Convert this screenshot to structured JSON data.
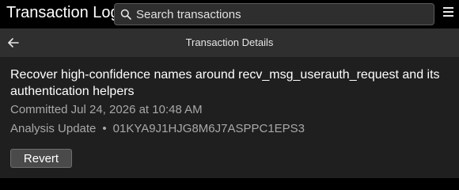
{
  "header": {
    "app_title": "Transaction Log",
    "search": {
      "placeholder": "Search transactions",
      "icon": "search-icon"
    },
    "menu_icon": "hamburger-menu-icon"
  },
  "subheader": {
    "back_icon": "arrow-left-icon",
    "title": "Transaction Details"
  },
  "transaction": {
    "message": "Recover high-confidence names around recv_msg_userauth_request and its authentication helpers",
    "committed": "Committed Jul 24, 2026 at 10:48 AM",
    "type": "Analysis Update",
    "separator": "•",
    "id": "01KYA9J1HJG8M6J7ASPPC1EPS3"
  },
  "actions": {
    "revert_label": "Revert"
  },
  "colors": {
    "header_bg": "#000000",
    "subheader_bg": "#2f2f2f",
    "content_bg": "#1f1f1f",
    "muted_text": "#a8a8a8",
    "button_bg": "#4a4a4a"
  }
}
